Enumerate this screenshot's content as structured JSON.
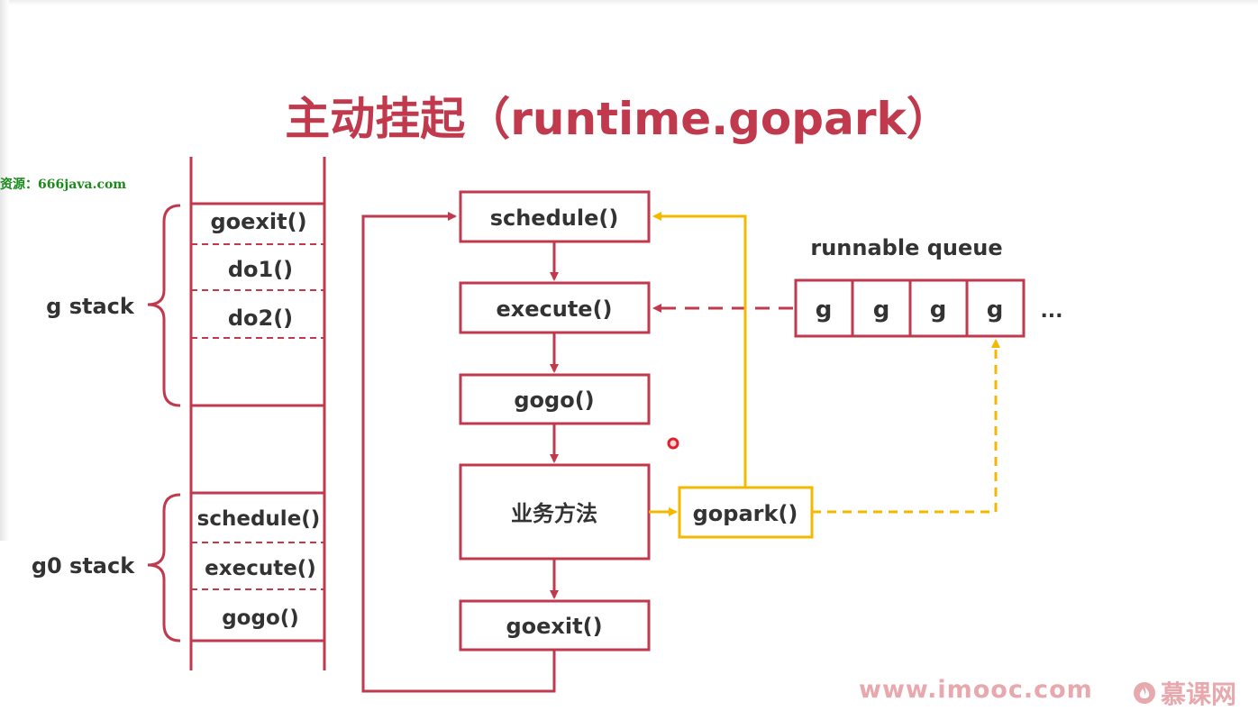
{
  "title": "主动挂起（runtime.gopark）",
  "watermark_source": "资源：666java.com",
  "stacks": {
    "g_stack_label": "g stack",
    "g0_stack_label": "g0 stack",
    "g_frames": [
      "goexit()",
      "do1()",
      "do2()"
    ],
    "g0_frames": [
      "schedule()",
      "execute()",
      "gogo()"
    ]
  },
  "flow": {
    "schedule": "schedule()",
    "execute": "execute()",
    "gogo": "gogo()",
    "business": "业务方法",
    "goexit": "goexit()",
    "gopark": "gopark()"
  },
  "runnable_queue": {
    "label": "runnable queue",
    "cells": [
      "g",
      "g",
      "g",
      "g"
    ],
    "ellipsis": "..."
  },
  "footer": {
    "url": "www.imooc.com",
    "brand": "慕课网"
  },
  "colors": {
    "primary": "#c0394d",
    "accent": "#f5b800",
    "text": "#333333",
    "footer": "#e7a9ae",
    "watermark": "#1a8a1a"
  }
}
